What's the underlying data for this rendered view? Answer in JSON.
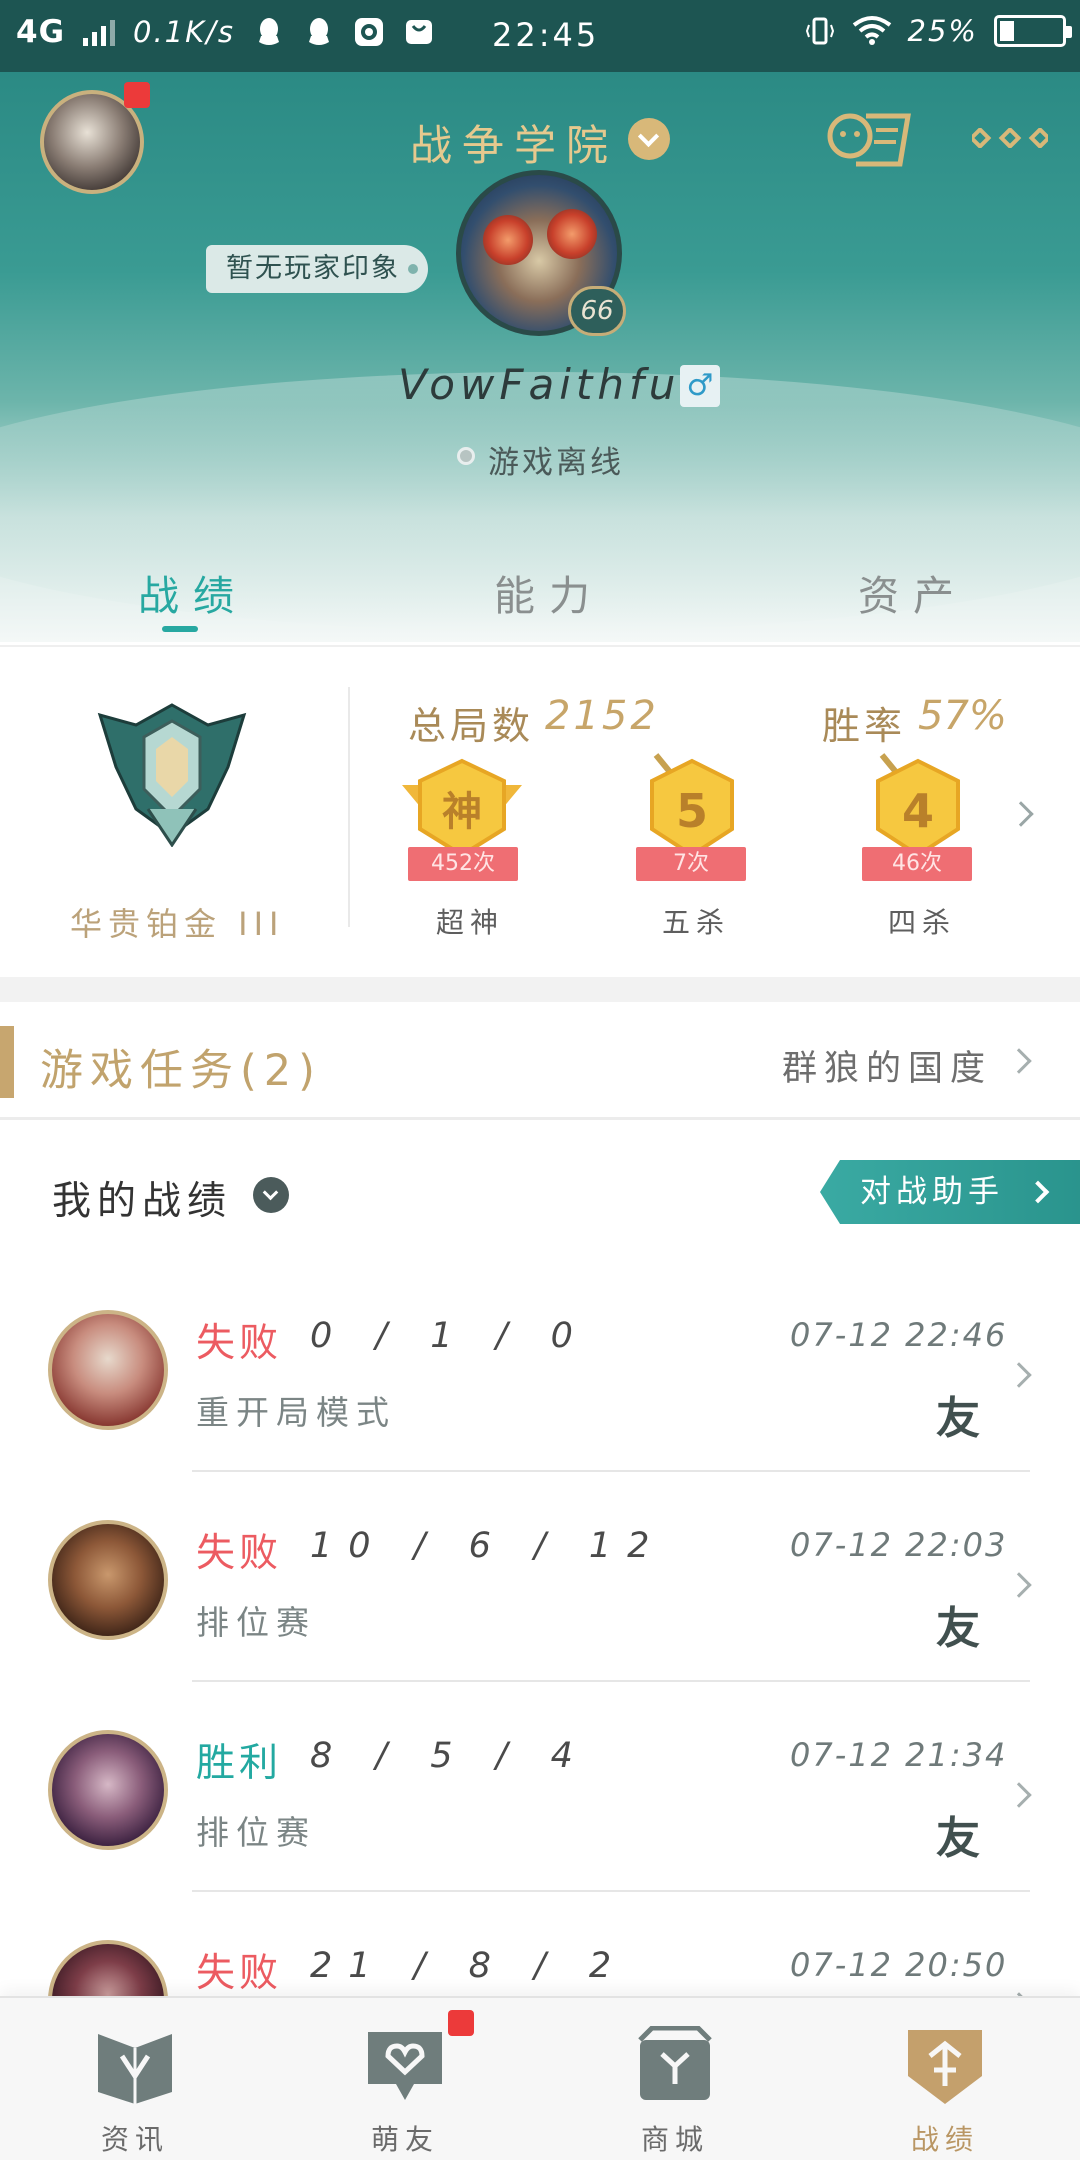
{
  "status_bar": {
    "network": "4G",
    "speed": "0.1K/s",
    "time": "22:45",
    "battery": "25%"
  },
  "header": {
    "title": "战争学院",
    "impression": "暂无玩家印象",
    "level": "66",
    "username": "VowFaithful",
    "gender_symbol": "♂",
    "online_status": "游戏离线"
  },
  "tabs": [
    {
      "label": "战绩",
      "active": true
    },
    {
      "label": "能力",
      "active": false
    },
    {
      "label": "资产",
      "active": false
    }
  ],
  "stats": {
    "rank_name": "华贵铂金 III",
    "total_label": "总局数",
    "total_value": "2152",
    "winrate_label": "胜率",
    "winrate_value": "57%",
    "medals": [
      {
        "glyph": "神",
        "count": "452次",
        "label": "超神"
      },
      {
        "glyph": "5",
        "count": "7次",
        "label": "五杀"
      },
      {
        "glyph": "4",
        "count": "46次",
        "label": "四杀"
      }
    ]
  },
  "task": {
    "title": "游戏任务(2)",
    "right_text": "群狼的国度"
  },
  "my_record": {
    "title": "我的战绩",
    "assist_button": "对战助手"
  },
  "matches": [
    {
      "result": "失败",
      "outcome": "lose",
      "kda": "0 / 1 / 0",
      "mode": "重开局模式",
      "time": "07-12 22:46",
      "badge": "友"
    },
    {
      "result": "失败",
      "outcome": "lose",
      "kda": "10 / 6 / 12",
      "mode": "排位赛",
      "time": "07-12 22:03",
      "badge": "友"
    },
    {
      "result": "胜利",
      "outcome": "win",
      "kda": "8 / 5 / 4",
      "mode": "排位赛",
      "time": "07-12 21:34",
      "badge": "友"
    },
    {
      "result": "失败",
      "outcome": "lose",
      "kda": "21 / 8 / 2",
      "mode": "",
      "time": "07-12 20:50",
      "badge": ""
    }
  ],
  "bottom_nav": [
    {
      "label": "资讯",
      "icon": "news-icon",
      "active": false
    },
    {
      "label": "萌友",
      "icon": "friends-icon",
      "active": false
    },
    {
      "label": "商城",
      "icon": "shop-icon",
      "active": false
    },
    {
      "label": "战绩",
      "icon": "record-icon",
      "active": true
    }
  ],
  "colors": {
    "header_teal": "#2b8a84",
    "accent_teal": "#27a8a1",
    "gold": "#c7a569",
    "lose_red": "#ec5b61",
    "notify_red": "#ec3a3a"
  }
}
